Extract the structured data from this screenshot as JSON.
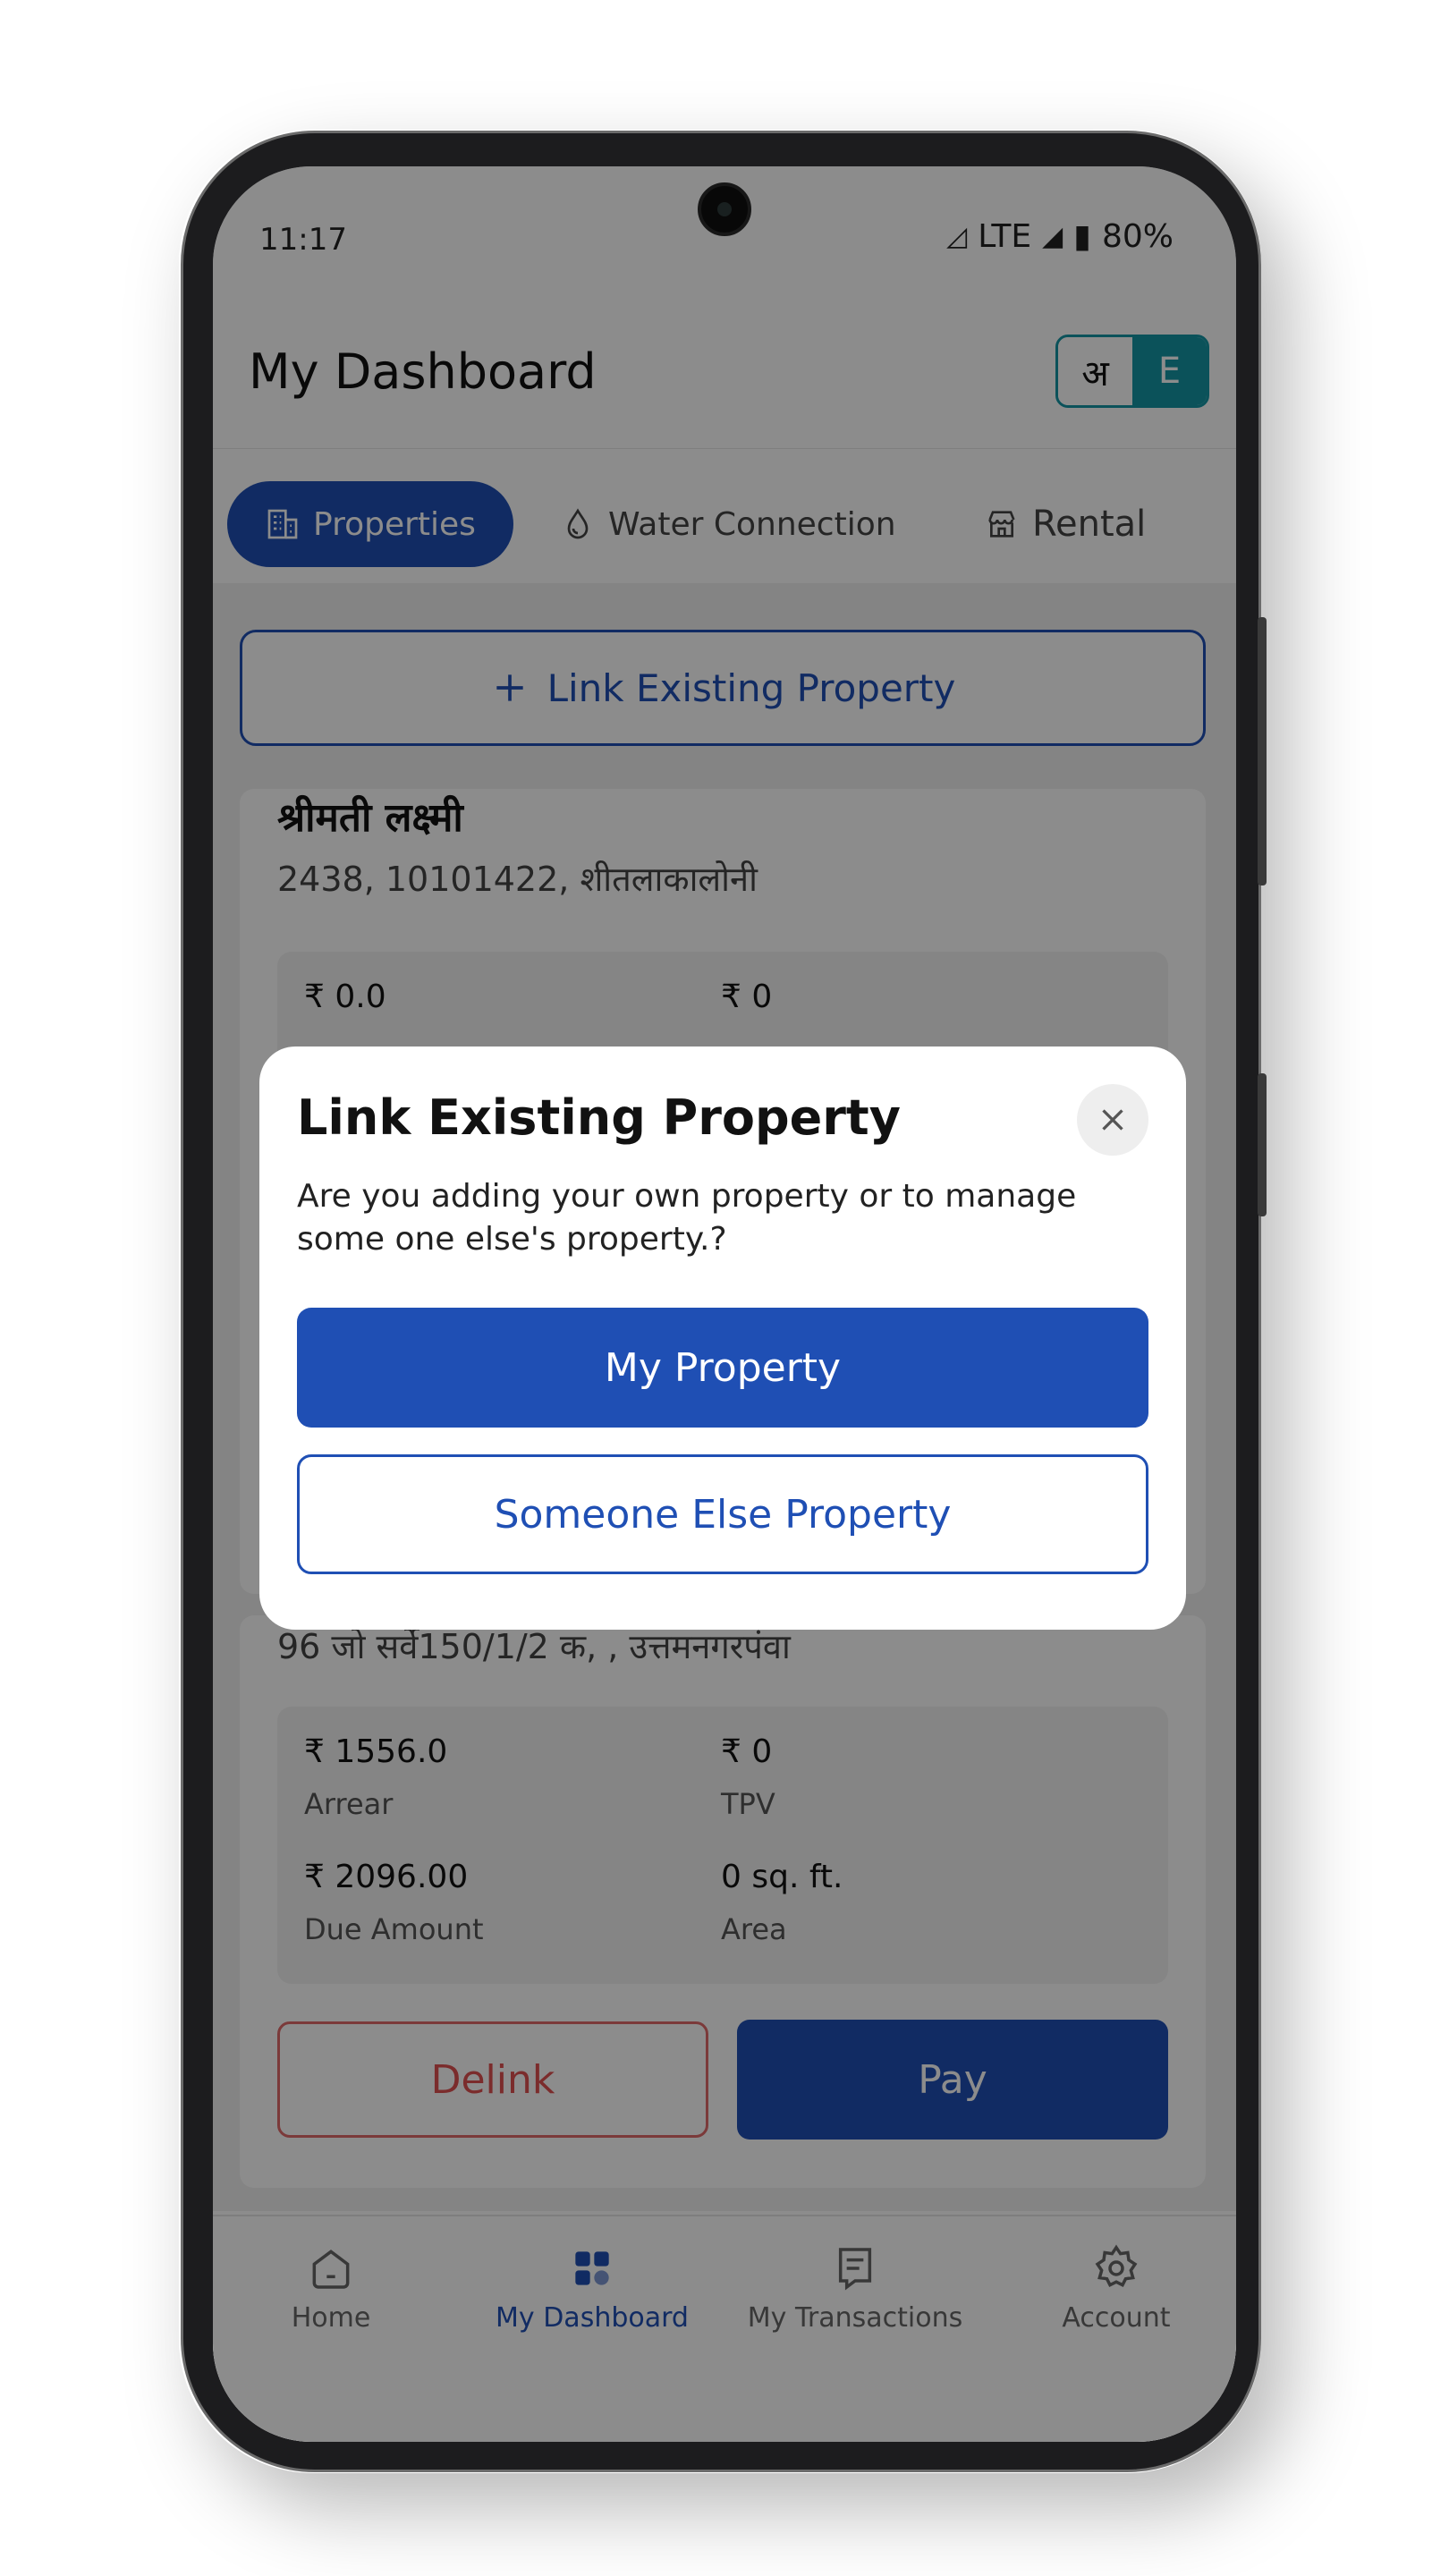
{
  "status_bar": {
    "time": "11:17",
    "network": "LTE",
    "battery": "80%"
  },
  "header": {
    "title": "My Dashboard",
    "lang_hi": "अ",
    "lang_en": "E"
  },
  "tabs": [
    {
      "label": "Properties",
      "icon": "building-icon",
      "active": true
    },
    {
      "label": "Water Connection",
      "icon": "water-drop-icon",
      "active": false
    },
    {
      "label": "Rental",
      "icon": "store-icon",
      "active": false
    }
  ],
  "link_button": {
    "label": "Link Existing Property"
  },
  "cards": [
    {
      "name": "श्रीमती लक्ष्मी",
      "address": "2438, 10101422, शीतलाकालोनी",
      "arrear": "₹ 0.0",
      "tpv": "₹ 0"
    },
    {
      "address": "96 जो सर्वे150/1/2 क, , उत्तमनगरपंवा",
      "arrear": "₹ 1556.0",
      "arrear_label": "Arrear",
      "tpv": "₹ 0",
      "tpv_label": "TPV",
      "due_amount": "₹ 2096.00",
      "due_label": "Due Amount",
      "area": "0 sq. ft.",
      "area_label": "Area",
      "delink_label": "Delink",
      "pay_label": "Pay"
    }
  ],
  "bottom_nav": [
    {
      "label": "Home",
      "icon": "home-icon",
      "active": false
    },
    {
      "label": "My Dashboard",
      "icon": "dashboard-icon",
      "active": true
    },
    {
      "label": "My Transactions",
      "icon": "receipt-icon",
      "active": false
    },
    {
      "label": "Account",
      "icon": "gear-icon",
      "active": false
    }
  ],
  "modal": {
    "title": "Link Existing Property",
    "message": "Are you adding your own property or to manage some one else's property.?",
    "primary_label": "My Property",
    "secondary_label": "Someone Else Property"
  },
  "colors": {
    "primary": "#1f4fb4",
    "accent": "#1596a5",
    "danger": "#e05050"
  }
}
